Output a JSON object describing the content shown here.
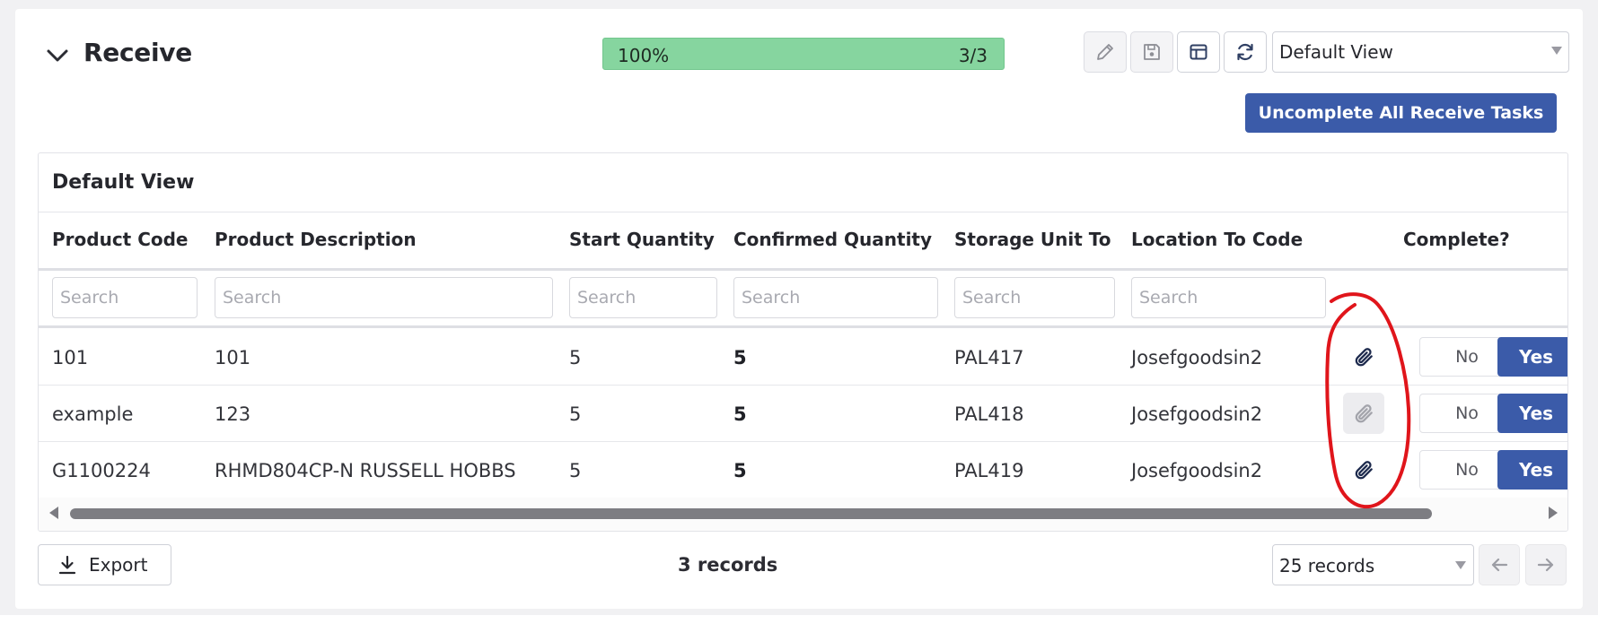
{
  "section": {
    "title": "Receive"
  },
  "progress": {
    "percent_label": "100%",
    "fraction_label": "3/3",
    "value": 1.0,
    "color": "#86d59f"
  },
  "toolbar": {
    "icons": [
      "pencil-icon",
      "save-icon",
      "layout-icon",
      "refresh-icon"
    ],
    "view_select": "Default View",
    "uncomplete_label": "Uncomplete All Receive Tasks"
  },
  "grid": {
    "title": "Default View",
    "columns": [
      "Product Code",
      "Product Description",
      "Start Quantity",
      "Confirmed Quantity",
      "Storage Unit To",
      "Location To Code",
      "Complete?"
    ],
    "search_placeholder": "Search",
    "rows": [
      {
        "product_code": "101",
        "description": "101",
        "start_qty": "5",
        "confirmed_qty": "5",
        "storage_unit": "PAL417",
        "location": "Josefgoodsin2",
        "no": "No",
        "yes": "Yes"
      },
      {
        "product_code": "example",
        "description": "123",
        "start_qty": "5",
        "confirmed_qty": "5",
        "storage_unit": "PAL418",
        "location": "Josefgoodsin2",
        "no": "No",
        "yes": "Yes"
      },
      {
        "product_code": "G1100224",
        "description": "RHMD804CP-N RUSSELL HOBBS",
        "start_qty": "5",
        "confirmed_qty": "5",
        "storage_unit": "PAL419",
        "location": "Josefgoodsin2",
        "no": "No",
        "yes": "Yes"
      }
    ],
    "scroll_fraction": 0.89
  },
  "footer": {
    "export_label": "Export",
    "records_count": "3 records",
    "page_size": "25 records"
  },
  "colors": {
    "primary": "#3b5ba9",
    "annotation": "#e0151b"
  }
}
